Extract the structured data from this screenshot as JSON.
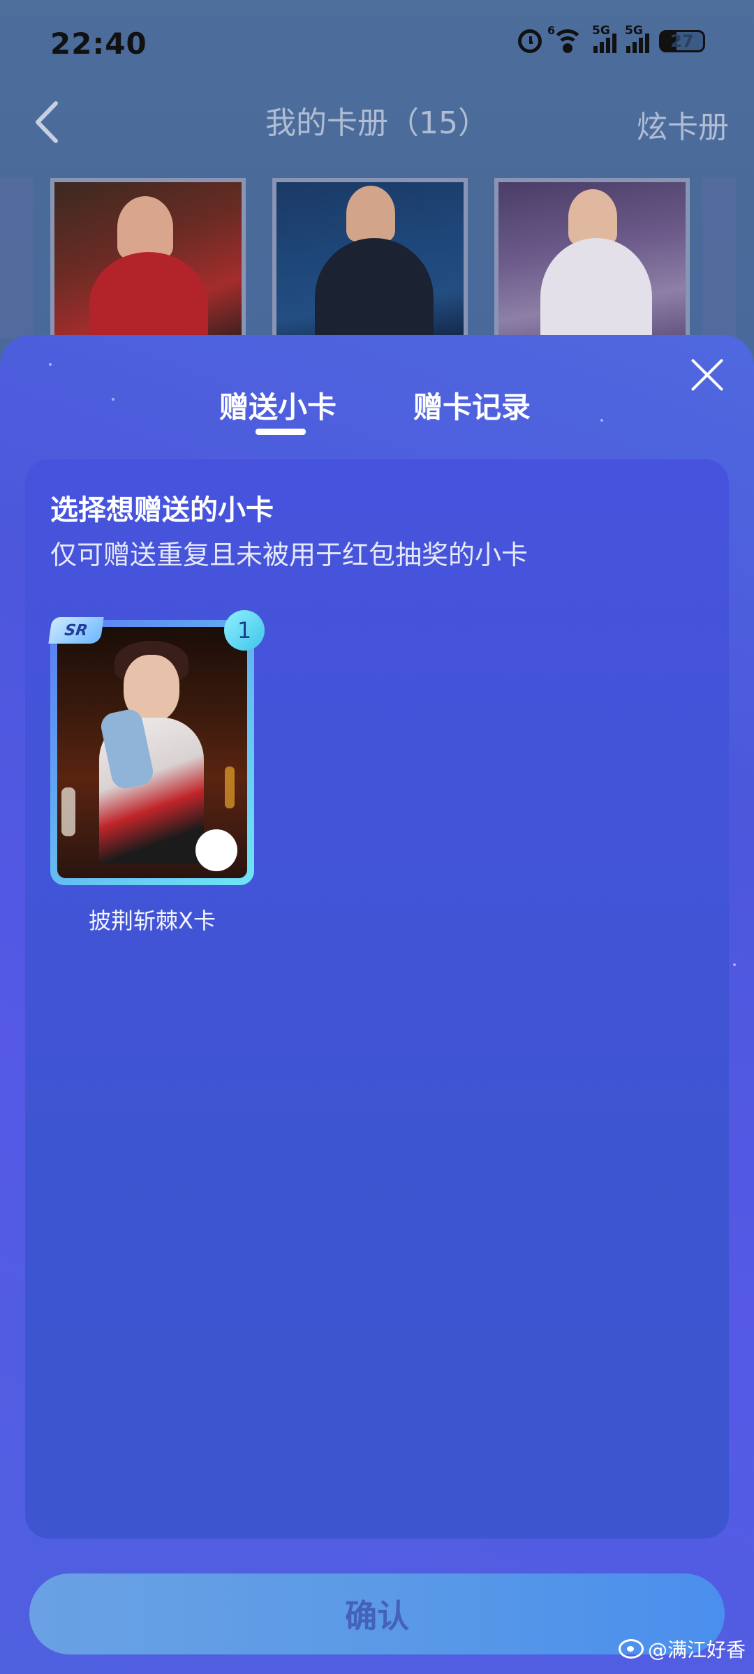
{
  "status_bar": {
    "time": "22:40",
    "signal1_label": "5G",
    "signal2_label": "5G",
    "wifi_label": "6",
    "battery": "27"
  },
  "nav": {
    "title": "我的卡册（15）",
    "right_action": "炫卡册"
  },
  "tabs": [
    {
      "label": "赠送小卡",
      "active": true
    },
    {
      "label": "赠卡记录",
      "active": false
    }
  ],
  "panel": {
    "title": "选择想赠送的小卡",
    "subtitle": "仅可赠送重复且未被用于红包抽奖的小卡"
  },
  "cards": [
    {
      "rarity": "SR",
      "count": "1",
      "name": "披荆斩棘X卡"
    }
  ],
  "confirm_label": "确认",
  "watermark": "@满江好香",
  "colors": {
    "sheet": "#4c57dc",
    "panel": "#4354d8",
    "confirm_button": "#5b9ae6",
    "confirm_text": "#4561b9"
  }
}
